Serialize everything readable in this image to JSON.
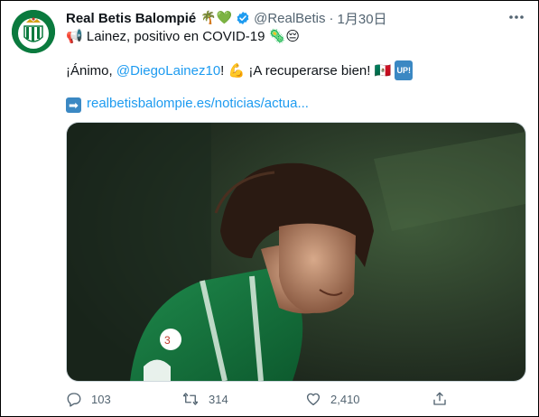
{
  "tweet": {
    "display_name": "Real Betis Balompié",
    "name_emojis": "🌴💚",
    "handle": "@RealBetis",
    "separator": "·",
    "date": "1月30日",
    "headline_emoji": "📢",
    "headline_text": "Lainez, positivo en COVID-19",
    "headline_emoji_end": "🦠😔",
    "body_prefix": "¡Ánimo, ",
    "mention": "@DiegoLainez10",
    "body_mid": "! ",
    "flex_emoji": "💪",
    "body_suffix": " ¡A recuperarse bien! ",
    "flag_emoji": "🇲🇽",
    "up_badge": "UP!",
    "link_arrow": "➡",
    "link_text": "realbetisbalompie.es/noticias/actua...",
    "more_icon": "more-icon"
  },
  "actions": {
    "reply_count": "103",
    "retweet_count": "314",
    "like_count": "2,410"
  },
  "colors": {
    "accent": "#1d9bf0",
    "muted": "#536471",
    "verified": "#1d9bf0",
    "betis_green": "#0a7a3e"
  }
}
